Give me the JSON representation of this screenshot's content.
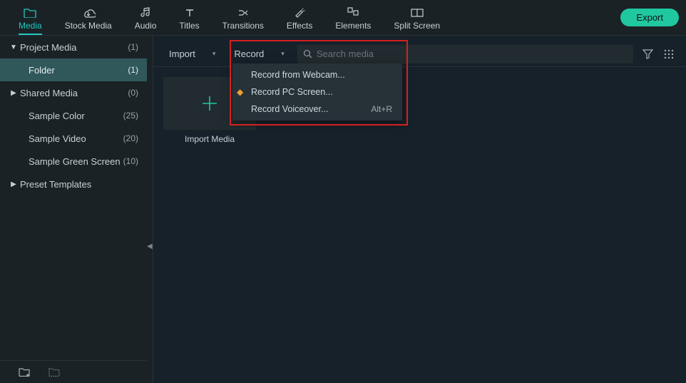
{
  "toolbar": {
    "tabs": [
      {
        "id": "media",
        "label": "Media"
      },
      {
        "id": "stock-media",
        "label": "Stock Media"
      },
      {
        "id": "audio",
        "label": "Audio"
      },
      {
        "id": "titles",
        "label": "Titles"
      },
      {
        "id": "transitions",
        "label": "Transitions"
      },
      {
        "id": "effects",
        "label": "Effects"
      },
      {
        "id": "elements",
        "label": "Elements"
      },
      {
        "id": "split-screen",
        "label": "Split Screen"
      }
    ],
    "export_label": "Export"
  },
  "sidebar": {
    "items": [
      {
        "label": "Project Media",
        "count": "(1)",
        "arrow": "down",
        "indent": false,
        "selected": false
      },
      {
        "label": "Folder",
        "count": "(1)",
        "arrow": "",
        "indent": true,
        "selected": true
      },
      {
        "label": "Shared Media",
        "count": "(0)",
        "arrow": "right",
        "indent": false,
        "selected": false
      },
      {
        "label": "Sample Color",
        "count": "(25)",
        "arrow": "",
        "indent": true,
        "selected": false
      },
      {
        "label": "Sample Video",
        "count": "(20)",
        "arrow": "",
        "indent": true,
        "selected": false
      },
      {
        "label": "Sample Green Screen",
        "count": "(10)",
        "arrow": "",
        "indent": true,
        "selected": false
      },
      {
        "label": "Preset Templates",
        "count": "",
        "arrow": "right",
        "indent": false,
        "selected": false
      }
    ]
  },
  "actionbar": {
    "import_label": "Import",
    "record_label": "Record",
    "search_placeholder": "Search media"
  },
  "record_menu": {
    "items": [
      {
        "label": "Record from Webcam...",
        "shortcut": "",
        "premium": false
      },
      {
        "label": "Record PC Screen...",
        "shortcut": "",
        "premium": true
      },
      {
        "label": "Record Voiceover...",
        "shortcut": "Alt+R",
        "premium": false
      }
    ]
  },
  "content": {
    "import_thumb_label": "Import Media"
  }
}
